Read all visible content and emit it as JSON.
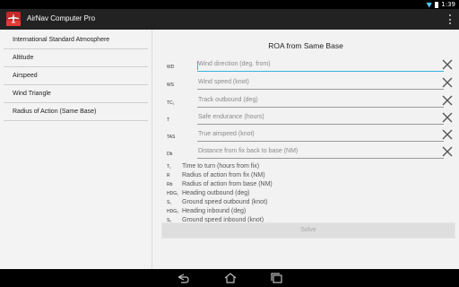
{
  "status_bar": {
    "time": "1:39"
  },
  "action_bar": {
    "title": "AirNav Computer Pro",
    "app_icon": "airplane-icon",
    "overflow_icon": "overflow-menu-icon"
  },
  "sidebar": {
    "items": [
      {
        "label": "International Standard Atmosphere"
      },
      {
        "label": "Altitude"
      },
      {
        "label": "Airspeed"
      },
      {
        "label": "Wind Triangle"
      },
      {
        "label": "Radius of Action (Same Base)"
      }
    ]
  },
  "main": {
    "title": "ROA from Same Base",
    "inputs": [
      {
        "tag": "WD",
        "placeholder": "Wind direction (deg. from)"
      },
      {
        "tag": "WS",
        "placeholder": "Wind speed (knot)"
      },
      {
        "tag": "TC₁",
        "placeholder": "Track outbound (deg)"
      },
      {
        "tag": "T",
        "placeholder": "Safe endurance (hours)"
      },
      {
        "tag": "TAS",
        "placeholder": "True airspeed (knot)"
      },
      {
        "tag": "Db",
        "placeholder": "Distance from fix back to base (NM)"
      }
    ],
    "outputs": [
      {
        "tag": "T₁",
        "label": "Time to turn (hours from fix)"
      },
      {
        "tag": "R",
        "label": "Radius of action from fix (NM)"
      },
      {
        "tag": "Rb",
        "label": "Radius of action from base (NM)"
      },
      {
        "tag": "HDG₁",
        "label": "Heading outbound (deg)"
      },
      {
        "tag": "S₁",
        "label": "Ground speed outbound (knot)"
      },
      {
        "tag": "HDG₂",
        "label": "Heading inbound (deg)"
      },
      {
        "tag": "S₂",
        "label": "Ground speed inbound (knot)"
      }
    ],
    "solve_label": "Solve"
  },
  "colors": {
    "accent": "#33b5e5",
    "clear_icon": "#555555"
  }
}
